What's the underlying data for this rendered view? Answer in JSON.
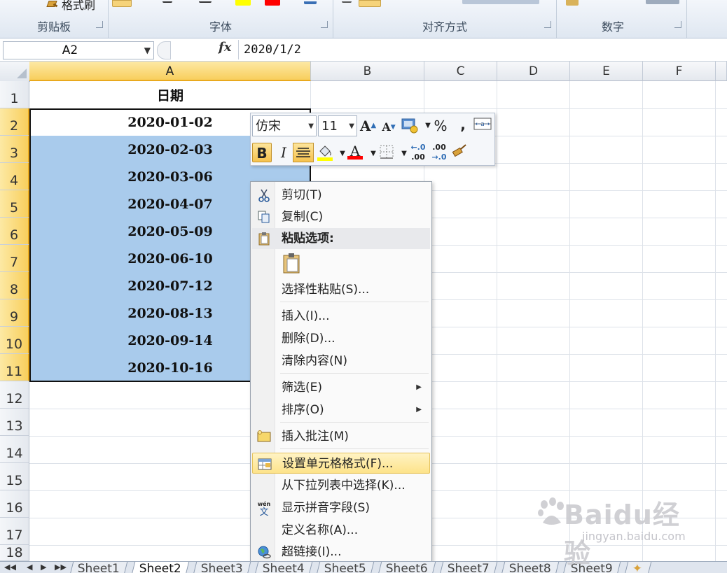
{
  "ribbon": {
    "format_painter": "格式刷",
    "groups": [
      "剪贴板",
      "字体",
      "对齐方式",
      "数字"
    ]
  },
  "formula_bar": {
    "name_box": "A2",
    "fx": "fx",
    "value": "2020/1/2"
  },
  "grid": {
    "columns": [
      "A",
      "B",
      "C",
      "D",
      "E",
      "F"
    ],
    "rows": [
      "1",
      "2",
      "3",
      "4",
      "5",
      "6",
      "7",
      "8",
      "9",
      "10",
      "11",
      "12",
      "13",
      "14",
      "15",
      "16",
      "17",
      "18"
    ],
    "cells": {
      "A1": "日期",
      "A2": "2020-01-02",
      "A3": "2020-02-03",
      "A4": "2020-03-06",
      "A5": "2020-04-07",
      "A6": "2020-05-09",
      "A7": "2020-06-10",
      "A8": "2020-07-12",
      "A9": "2020-08-13",
      "A10": "2020-09-14",
      "A11": "2020-10-16"
    },
    "selection": "A2:A11",
    "selection_color": "#a9cbec"
  },
  "mini_toolbar": {
    "font": "仿宋",
    "size": "11",
    "grow": "A",
    "shrink": "A",
    "percent": "%",
    "comma": ",",
    "bold": "B",
    "italic": "I",
    "font_color_letter": "A",
    "inc_decimal": "←.0",
    "dec_decimal": ".00",
    "highlight_color": "#ffff00",
    "font_color": "#ff0000"
  },
  "context_menu": {
    "cut": "剪切(T)",
    "copy": "复制(C)",
    "paste_options": "粘贴选项:",
    "paste_special": "选择性粘贴(S)...",
    "insert": "插入(I)...",
    "delete": "删除(D)...",
    "clear": "清除内容(N)",
    "filter": "筛选(E)",
    "sort": "排序(O)",
    "insert_comment": "插入批注(M)",
    "format_cells": "设置单元格格式(F)...",
    "pick_list": "从下拉列表中选择(K)...",
    "phonetic": "显示拼音字段(S)",
    "define_name": "定义名称(A)...",
    "hyperlink": "超链接(I)..."
  },
  "sheets": {
    "tabs": [
      "Sheet1",
      "Sheet2",
      "Sheet3",
      "Sheet4",
      "Sheet5",
      "Sheet6",
      "Sheet7",
      "Sheet8",
      "Sheet9"
    ],
    "active": "Sheet2"
  },
  "watermark": {
    "brand": "Baidu经验",
    "url": "jingyan.baidu.com"
  }
}
